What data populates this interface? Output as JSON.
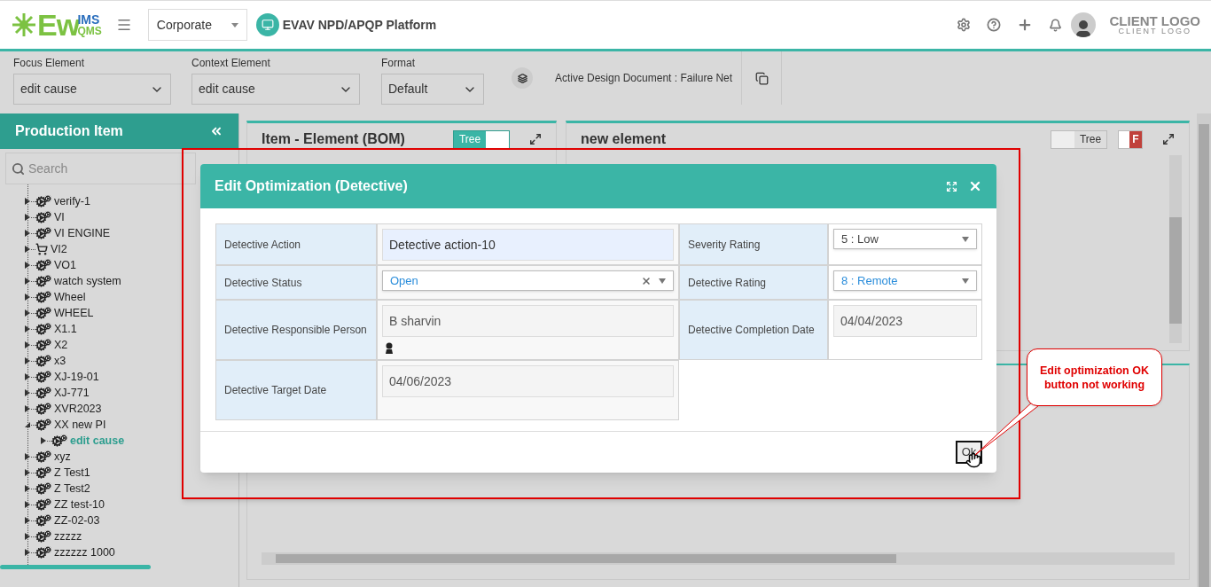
{
  "header": {
    "logo": {
      "mark": "Ew",
      "top": "IMS",
      "bottom": "QMS"
    },
    "company": "Corporate",
    "platform": "EVAV NPD/APQP Platform",
    "client_logo": "CLIENT LOGO",
    "client_logo_sub": "CLIENT LOGO"
  },
  "toolbar": {
    "fields": [
      {
        "label": "Focus Element",
        "value": "edit cause"
      },
      {
        "label": "Context Element",
        "value": "edit cause"
      },
      {
        "label": "Format",
        "value": "Default"
      }
    ],
    "active_document": "Active Design Document : Failure Net"
  },
  "sidebar": {
    "title": "Production Item",
    "search": {
      "placeholder": "Search"
    },
    "tree": [
      {
        "label": "verify-1",
        "kind": "gears",
        "expanded": false,
        "selected": false
      },
      {
        "label": "VI",
        "kind": "gears",
        "expanded": false,
        "selected": false
      },
      {
        "label": "VI ENGINE",
        "kind": "gears",
        "expanded": false,
        "selected": false
      },
      {
        "label": "VI2",
        "kind": "cart",
        "expanded": false,
        "selected": false
      },
      {
        "label": "VO1",
        "kind": "gears",
        "expanded": false,
        "selected": false
      },
      {
        "label": "watch system",
        "kind": "gears",
        "expanded": false,
        "selected": false
      },
      {
        "label": "Wheel",
        "kind": "gears",
        "expanded": false,
        "selected": false
      },
      {
        "label": "WHEEL",
        "kind": "gears",
        "expanded": false,
        "selected": false
      },
      {
        "label": "X1.1",
        "kind": "gears",
        "expanded": false,
        "selected": false
      },
      {
        "label": "X2",
        "kind": "gears",
        "expanded": false,
        "selected": false
      },
      {
        "label": "x3",
        "kind": "gears",
        "expanded": false,
        "selected": false
      },
      {
        "label": "XJ-19-01",
        "kind": "gears",
        "expanded": false,
        "selected": false
      },
      {
        "label": "XJ-771",
        "kind": "gears",
        "expanded": false,
        "selected": false
      },
      {
        "label": "XVR2023",
        "kind": "gears",
        "expanded": false,
        "selected": false
      },
      {
        "label": "XX new PI",
        "kind": "gears",
        "expanded": true,
        "selected": false,
        "children": [
          {
            "label": "edit cause",
            "kind": "gears",
            "expanded": false,
            "selected": true
          }
        ]
      },
      {
        "label": "xyz",
        "kind": "gears",
        "expanded": false,
        "selected": false
      },
      {
        "label": "Z Test1",
        "kind": "gears",
        "expanded": false,
        "selected": false
      },
      {
        "label": "Z Test2",
        "kind": "gears",
        "expanded": false,
        "selected": false
      },
      {
        "label": "ZZ test-10",
        "kind": "gears",
        "expanded": false,
        "selected": false
      },
      {
        "label": "ZZ-02-03",
        "kind": "gears",
        "expanded": false,
        "selected": false
      },
      {
        "label": "zzzzz",
        "kind": "gears",
        "expanded": false,
        "selected": false
      },
      {
        "label": "zzzzzz 1000",
        "kind": "gears",
        "expanded": false,
        "selected": false
      }
    ]
  },
  "panels": [
    {
      "title": "Item - Element (BOM)",
      "toggles": [
        {
          "label": "Tree",
          "kind": "view",
          "on": true
        }
      ]
    },
    {
      "title": "new element",
      "toggles": [
        {
          "label": "Tree",
          "kind": "view",
          "on": false
        },
        {
          "label": "F",
          "kind": "flag",
          "on": false
        }
      ]
    }
  ],
  "dialog": {
    "title": "Edit Optimization (Detective)",
    "left": [
      {
        "label": "Detective Action",
        "kind": "text",
        "value": "Detective action-10"
      },
      {
        "label": "Detective Status",
        "kind": "select",
        "value": "Open",
        "changed": true,
        "clearable": true
      },
      {
        "label": "Detective Responsible Person",
        "kind": "person",
        "value": "B sharvin"
      },
      {
        "label": "Detective Target Date",
        "kind": "readonly",
        "value": "04/06/2023"
      }
    ],
    "right": [
      {
        "label": "Severity Rating",
        "kind": "select",
        "value": "5 : Low",
        "changed": false,
        "clearable": false
      },
      {
        "label": "Detective Rating",
        "kind": "select",
        "value": "8 : Remote",
        "changed": true,
        "clearable": false
      },
      {
        "label": "Detective Completion Date",
        "kind": "readonly",
        "value": "04/04/2023"
      }
    ],
    "ok": "Ok"
  },
  "annotation": "Edit optimization OK button not working"
}
